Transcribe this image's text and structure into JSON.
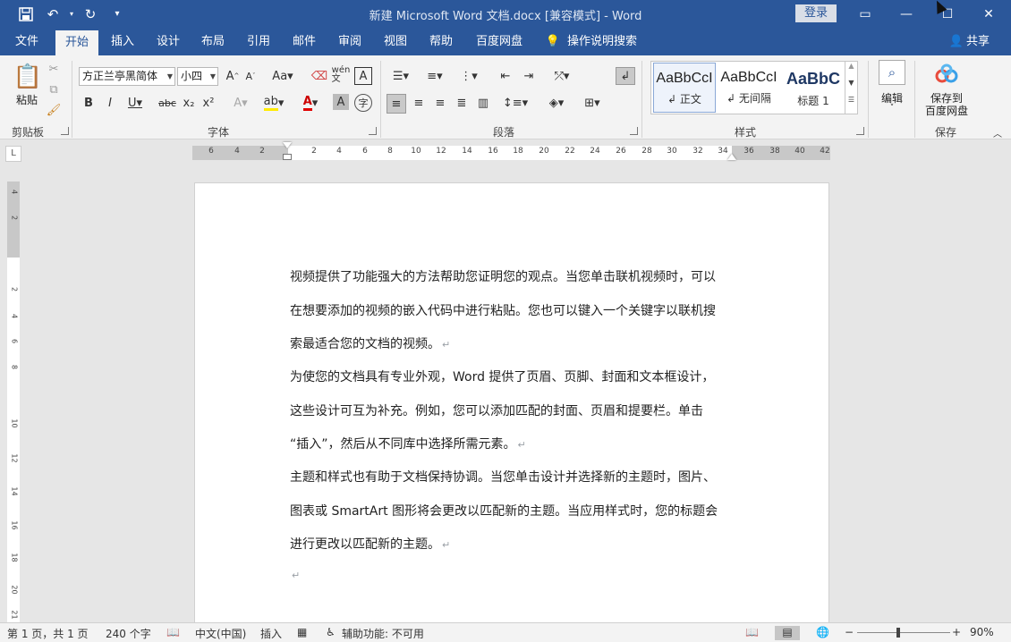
{
  "window": {
    "title": "新建 Microsoft Word 文档.docx [兼容模式]  -  Word",
    "login": "登录",
    "controls": {
      "ribbon_display": "▭",
      "minimize": "—",
      "maximize": "☐",
      "close": "✕"
    }
  },
  "qat": {
    "save_icon": "save-icon",
    "undo_icon": "undo-icon",
    "redo_icon": "redo-icon",
    "customize_icon": "customize-icon"
  },
  "tabs": [
    {
      "label": "文件"
    },
    {
      "label": "开始"
    },
    {
      "label": "插入"
    },
    {
      "label": "设计"
    },
    {
      "label": "布局"
    },
    {
      "label": "引用"
    },
    {
      "label": "邮件"
    },
    {
      "label": "审阅"
    },
    {
      "label": "视图"
    },
    {
      "label": "帮助"
    },
    {
      "label": "百度网盘"
    },
    {
      "label": "操作说明搜索"
    }
  ],
  "active_tab": "开始",
  "share": "共享",
  "ribbon": {
    "clipboard": {
      "paste": "粘贴",
      "label": "剪贴板"
    },
    "font": {
      "family": "方正兰亭黑简体",
      "size": "小四",
      "label": "字体"
    },
    "paragraph": {
      "label": "段落"
    },
    "styles": {
      "label": "样式",
      "items": [
        {
          "sample": "AaBbCcI",
          "name": "正文"
        },
        {
          "sample": "AaBbCcI",
          "name": "无间隔"
        },
        {
          "sample": "AaBbC",
          "name": "标题 1"
        }
      ]
    },
    "editing": {
      "label": "编辑"
    },
    "save": {
      "button": "保存到\n百度网盘",
      "label": "保存"
    }
  },
  "ruler": {
    "h_numbers": [
      "6",
      "4",
      "2",
      "2",
      "4",
      "6",
      "8",
      "10",
      "12",
      "14",
      "16",
      "18",
      "20",
      "22",
      "24",
      "26",
      "28",
      "30",
      "32",
      "34",
      "36",
      "38",
      "40",
      "42"
    ],
    "v_numbers": [
      "4",
      "2",
      "2",
      "4",
      "6",
      "8",
      "10",
      "12",
      "14",
      "16",
      "18",
      "20",
      "21"
    ]
  },
  "document": {
    "lines": [
      "视频提供了功能强大的方法帮助您证明您的观点。当您单击联机视频时，可以",
      "在想要添加的视频的嵌入代码中进行粘贴。您也可以键入一个关键字以联机搜",
      "索最适合您的文档的视频。",
      "为使您的文档具有专业外观，Word 提供了页眉、页脚、封面和文本框设计，",
      "这些设计可互为补充。例如，您可以添加匹配的封面、页眉和提要栏。单击",
      "“插入”，然后从不同库中选择所需元素。",
      "主题和样式也有助于文档保持协调。当您单击设计并选择新的主题时，图片、",
      "图表或 SmartArt 图形将会更改以匹配新的主题。当应用样式时，您的标题会",
      "进行更改以匹配新的主题。",
      ""
    ]
  },
  "status": {
    "page": "第 1 页，共 1 页",
    "words": "240 个字",
    "language": "中文(中国)",
    "mode": "插入",
    "accessibility": "辅助功能: 不可用",
    "zoom": "90%",
    "zoom_minus": "−",
    "zoom_plus": "+"
  }
}
